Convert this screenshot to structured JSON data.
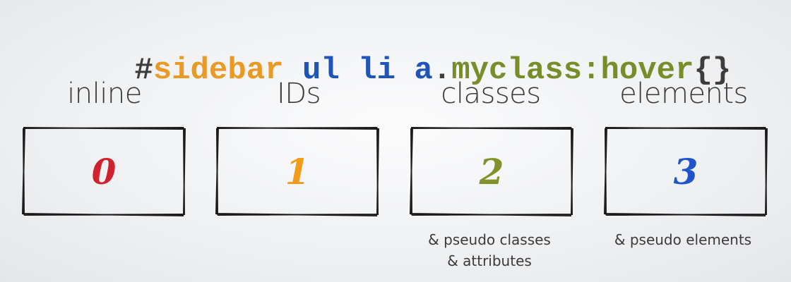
{
  "selector": {
    "parts": [
      {
        "text": "#",
        "color": "#3d3d3d"
      },
      {
        "text": "sidebar",
        "color": "#e89a24"
      },
      {
        "text": " ul li a",
        "color": "#1f55b8"
      },
      {
        "text": ".",
        "color": "#3d3d3d"
      },
      {
        "text": "myclass",
        "color": "#7a8c2a"
      },
      {
        "text": ":hover",
        "color": "#7a8c2a"
      },
      {
        "text": "{}",
        "color": "#3d3d3d"
      }
    ]
  },
  "columns": [
    {
      "label": "inline",
      "value": "0",
      "color": "#d0222e",
      "notes": []
    },
    {
      "label": "IDs",
      "value": "1",
      "color": "#f29a1a",
      "notes": []
    },
    {
      "label": "classes",
      "value": "2",
      "color": "#84912a",
      "notes": [
        "& pseudo classes",
        "& attributes"
      ]
    },
    {
      "label": "elements",
      "value": "3",
      "color": "#1f55c8",
      "notes": [
        "& pseudo elements"
      ]
    }
  ]
}
